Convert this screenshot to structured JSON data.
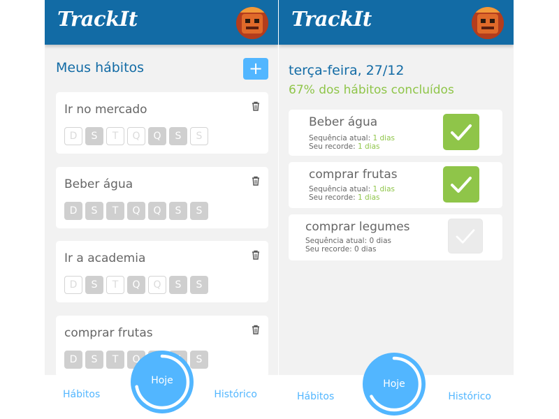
{
  "app": {
    "logo": "TrackIt"
  },
  "colors": {
    "header": "#126ba5",
    "accent": "#52b6ff",
    "done": "#8fc549",
    "card": "#ffffff",
    "background": "#f2f2f2"
  },
  "habits_screen": {
    "title": "Meus hábitos",
    "add_label": "+",
    "habits": [
      {
        "name": "Ir no mercado",
        "days": [
          {
            "label": "D",
            "selected": false
          },
          {
            "label": "S",
            "selected": true
          },
          {
            "label": "T",
            "selected": false
          },
          {
            "label": "Q",
            "selected": false
          },
          {
            "label": "Q",
            "selected": true
          },
          {
            "label": "S",
            "selected": true
          },
          {
            "label": "S",
            "selected": false
          }
        ]
      },
      {
        "name": "Beber água",
        "days": [
          {
            "label": "D",
            "selected": true
          },
          {
            "label": "S",
            "selected": true
          },
          {
            "label": "T",
            "selected": true
          },
          {
            "label": "Q",
            "selected": true
          },
          {
            "label": "Q",
            "selected": true
          },
          {
            "label": "S",
            "selected": true
          },
          {
            "label": "S",
            "selected": true
          }
        ]
      },
      {
        "name": "Ir a academia",
        "days": [
          {
            "label": "D",
            "selected": false
          },
          {
            "label": "S",
            "selected": true
          },
          {
            "label": "T",
            "selected": false
          },
          {
            "label": "Q",
            "selected": true
          },
          {
            "label": "Q",
            "selected": false
          },
          {
            "label": "S",
            "selected": true
          },
          {
            "label": "S",
            "selected": true
          }
        ]
      },
      {
        "name": "comprar frutas",
        "days": [
          {
            "label": "D",
            "selected": true
          },
          {
            "label": "S",
            "selected": true
          },
          {
            "label": "T",
            "selected": true
          },
          {
            "label": "Q",
            "selected": true
          },
          {
            "label": "Q",
            "selected": true
          },
          {
            "label": "S",
            "selected": true
          },
          {
            "label": "S",
            "selected": true
          }
        ]
      }
    ]
  },
  "today_screen": {
    "date": "terça-feira, 27/12",
    "progress": "67% dos hábitos concluídos",
    "progress_percent": 67,
    "habits": [
      {
        "name": "Beber água",
        "streak_label": "Sequência atual:",
        "streak": "1 dias",
        "record_label": "Seu recorde:",
        "record": "1 dias",
        "done": true
      },
      {
        "name": "comprar frutas",
        "streak_label": "Sequência atual:",
        "streak": "1 dias",
        "record_label": "Seu recorde:",
        "record": "1 dias",
        "done": true
      },
      {
        "name": "comprar legumes",
        "streak_label": "Sequência atual:",
        "streak": "0 dias",
        "record_label": "Seu recorde:",
        "record": "0 dias",
        "done": false
      }
    ]
  },
  "footer": {
    "habits_link": "Hábitos",
    "today_button": "Hoje",
    "history_link": "Histórico"
  },
  "footer_progress": {
    "habits_screen_fraction": 0.72,
    "today_screen_fraction": 0.67
  }
}
